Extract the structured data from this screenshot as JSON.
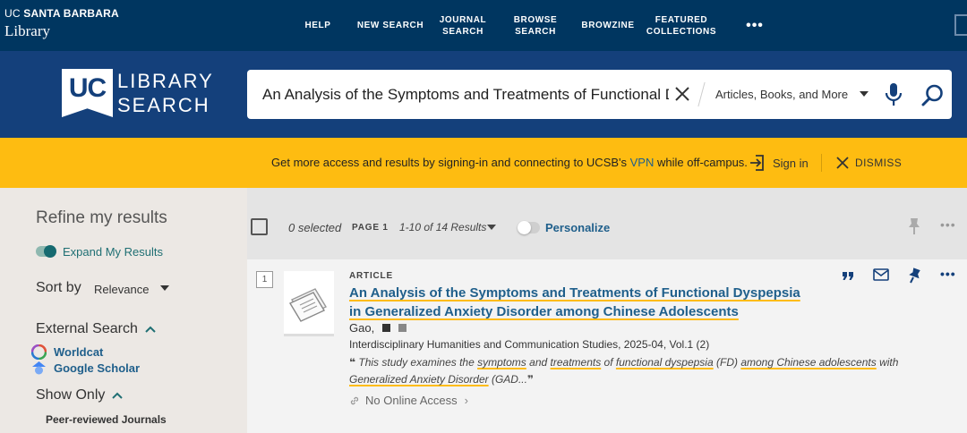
{
  "brand": {
    "line1_bold": "UC SANTA BARBARA",
    "line1_prefix": "UC",
    "line1_rest": "SANTA BARBARA",
    "line2": "Library"
  },
  "nav": {
    "items": [
      {
        "label": "HELP"
      },
      {
        "label": "NEW SEARCH"
      },
      {
        "label": "JOURNAL\nSEARCH"
      },
      {
        "label": "BROWSE\nSEARCH"
      },
      {
        "label": "BROWZINE"
      },
      {
        "label": "FEATURED\nCOLLECTIONS"
      }
    ],
    "more": "•••"
  },
  "logo": {
    "uc": "UC",
    "line1": "LIBRARY",
    "line2": "SEARCH"
  },
  "search": {
    "query": "An Analysis of the Symptoms and Treatments of Functional Dyspepsia in Generalized Anxiety Disorder among Chinese Adolescents",
    "scope": "Articles, Books, and More"
  },
  "banner": {
    "message_pre": "Get more access and results by signing-in and connecting to UCSB's",
    "vpn": "VPN",
    "message_post": "while off-campus.",
    "signin": "Sign in",
    "dismiss": "DISMISS"
  },
  "sidebar": {
    "refine": "Refine my results",
    "expand": "Expand My Results",
    "sort_label": "Sort by",
    "sort_value": "Relevance",
    "external_heading": "External Search",
    "external_links": [
      "Worldcat",
      "Google Scholar"
    ],
    "show_only_heading": "Show Only",
    "show_only_items": [
      "Peer-reviewed Journals"
    ]
  },
  "toolbar": {
    "selected": "0 selected",
    "page": "PAGE 1",
    "range": "1-10 of 14 Results",
    "personalize": "Personalize"
  },
  "results": [
    {
      "number": "1",
      "type": "ARTICLE",
      "title": "An Analysis of the Symptoms and Treatments of Functional Dyspepsia in Generalized Anxiety Disorder among Chinese Adolescents",
      "author": "Gao,",
      "publication": "Interdisciplinary Humanities and Communication Studies, 2025-04, Vol.1 (2)",
      "snippet": {
        "p1": "This study examines the ",
        "h1": "symptoms",
        "p2": " and ",
        "h2": "treatments",
        "p3": " of ",
        "h3": "functional dyspepsia",
        "p4": " (FD) ",
        "h4": "among Chinese adolescents",
        "p5": " with ",
        "h5": "Generalized Anxiety Disorder",
        "p6": " (GAD..."
      },
      "availability": "No Online Access"
    }
  ],
  "colors": {
    "nav_bg": "#003660",
    "search_band": "#14407b",
    "banner": "#febc11",
    "link": "#1f5f8b",
    "highlight": "#febc11"
  }
}
